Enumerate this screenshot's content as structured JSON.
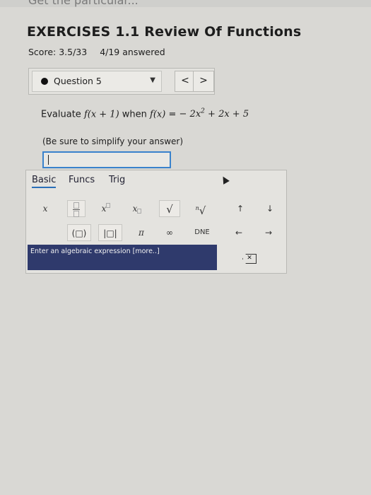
{
  "header": {
    "cut_title": "Get the particular...",
    "title": "EXERCISES 1.1 Review Of Functions",
    "score": "Score: 3.5/33",
    "answered": "4/19 answered"
  },
  "question_nav": {
    "selected": "Question 5",
    "prev_icon": "<",
    "next_icon": ">"
  },
  "question": {
    "prefix": "Evaluate",
    "fx1": "f(x + 1)",
    "when": "when",
    "fx": "f(x)",
    "equals": "=",
    "rhs_part1": "− 2x",
    "rhs_exp": "2",
    "rhs_part2": "+ 2x + 5",
    "hint": "(Be sure to simplify your answer)"
  },
  "answer": {
    "value": ""
  },
  "palette": {
    "tabs": [
      "Basic",
      "Funcs",
      "Trig"
    ],
    "keys": {
      "x": "x",
      "x_sup": "x",
      "x_sub": "x",
      "sqrt": "√",
      "nthroot_n": "n",
      "nthroot": "√",
      "up": "↑",
      "down": "↓",
      "paren": "(□)",
      "abs": "|□|",
      "pi": "π",
      "inf": "∞",
      "dne": "DNE",
      "left": "←",
      "right": "→",
      "backspace": "✕"
    },
    "status": "Enter an algebraic expression [more..]"
  }
}
